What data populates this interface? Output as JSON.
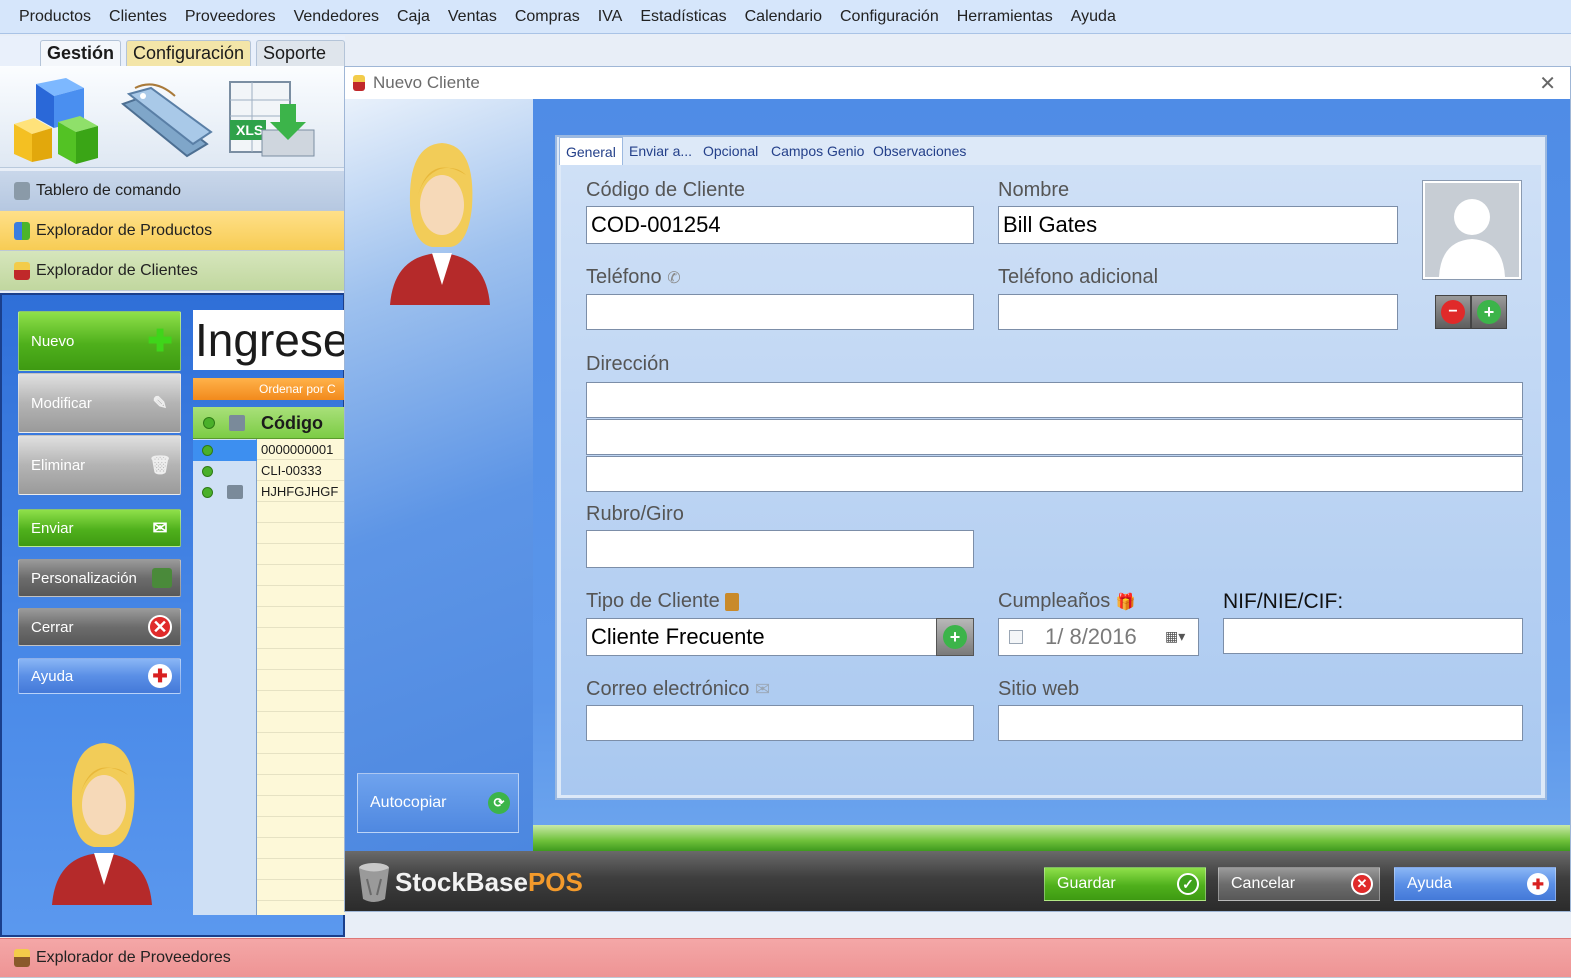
{
  "menu": [
    "Productos",
    "Clientes",
    "Proveedores",
    "Vendedores",
    "Caja",
    "Ventas",
    "Compras",
    "IVA",
    "Estadísticas",
    "Calendario",
    "Configuración",
    "Herramientas",
    "Ayuda"
  ],
  "ribbon": {
    "tabs": [
      "Gestión",
      "Configuración",
      "Soporte Técnico"
    ],
    "xls_label": "XLS"
  },
  "accordion": {
    "tablero": "Tablero de comando",
    "productos": "Explorador de Productos",
    "clientes": "Explorador de Clientes",
    "proveedores": "Explorador de Proveedores"
  },
  "left_buttons": {
    "nuevo": "Nuevo",
    "modificar": "Modificar",
    "eliminar": "Eliminar",
    "enviar": "Enviar",
    "personalizacion": "Personalización",
    "cerrar": "Cerrar",
    "ayuda": "Ayuda"
  },
  "search_text": "Ingrese",
  "sort_label": "Ordenar por C",
  "grid": {
    "header": "Código",
    "rows": [
      "0000000001",
      "CLI-00333",
      "HJHFGJHGF"
    ]
  },
  "dialog": {
    "title": "Nuevo Cliente",
    "tabs": [
      "General",
      "Enviar a...",
      "Opcional",
      "Campos Genio",
      "Observaciones"
    ],
    "labels": {
      "codigo": "Código de Cliente",
      "nombre": "Nombre",
      "telefono": "Teléfono",
      "telefono_adicional": "Teléfono adicional",
      "direccion": "Dirección",
      "rubro": "Rubro/Giro",
      "tipo": "Tipo de Cliente",
      "cumpleanos": "Cumpleaños",
      "nif": "NIF/NIE/CIF:",
      "correo": "Correo electrónico",
      "sitio": "Sitio web"
    },
    "values": {
      "codigo": "COD-001254",
      "nombre": "Bill Gates",
      "tipo": "Cliente Frecuente",
      "cumpleanos": "1/  8/2016"
    },
    "autocopiar": "Autocopiar",
    "brand": {
      "stock": "StockBase",
      "pos": "POS"
    },
    "footer": {
      "guardar": "Guardar",
      "cancelar": "Cancelar",
      "ayuda": "Ayuda"
    }
  },
  "colors": {
    "green_btn": "#4fb01c",
    "accent_blue": "#4d8ae6",
    "pos_orange": "#f39a2b"
  }
}
